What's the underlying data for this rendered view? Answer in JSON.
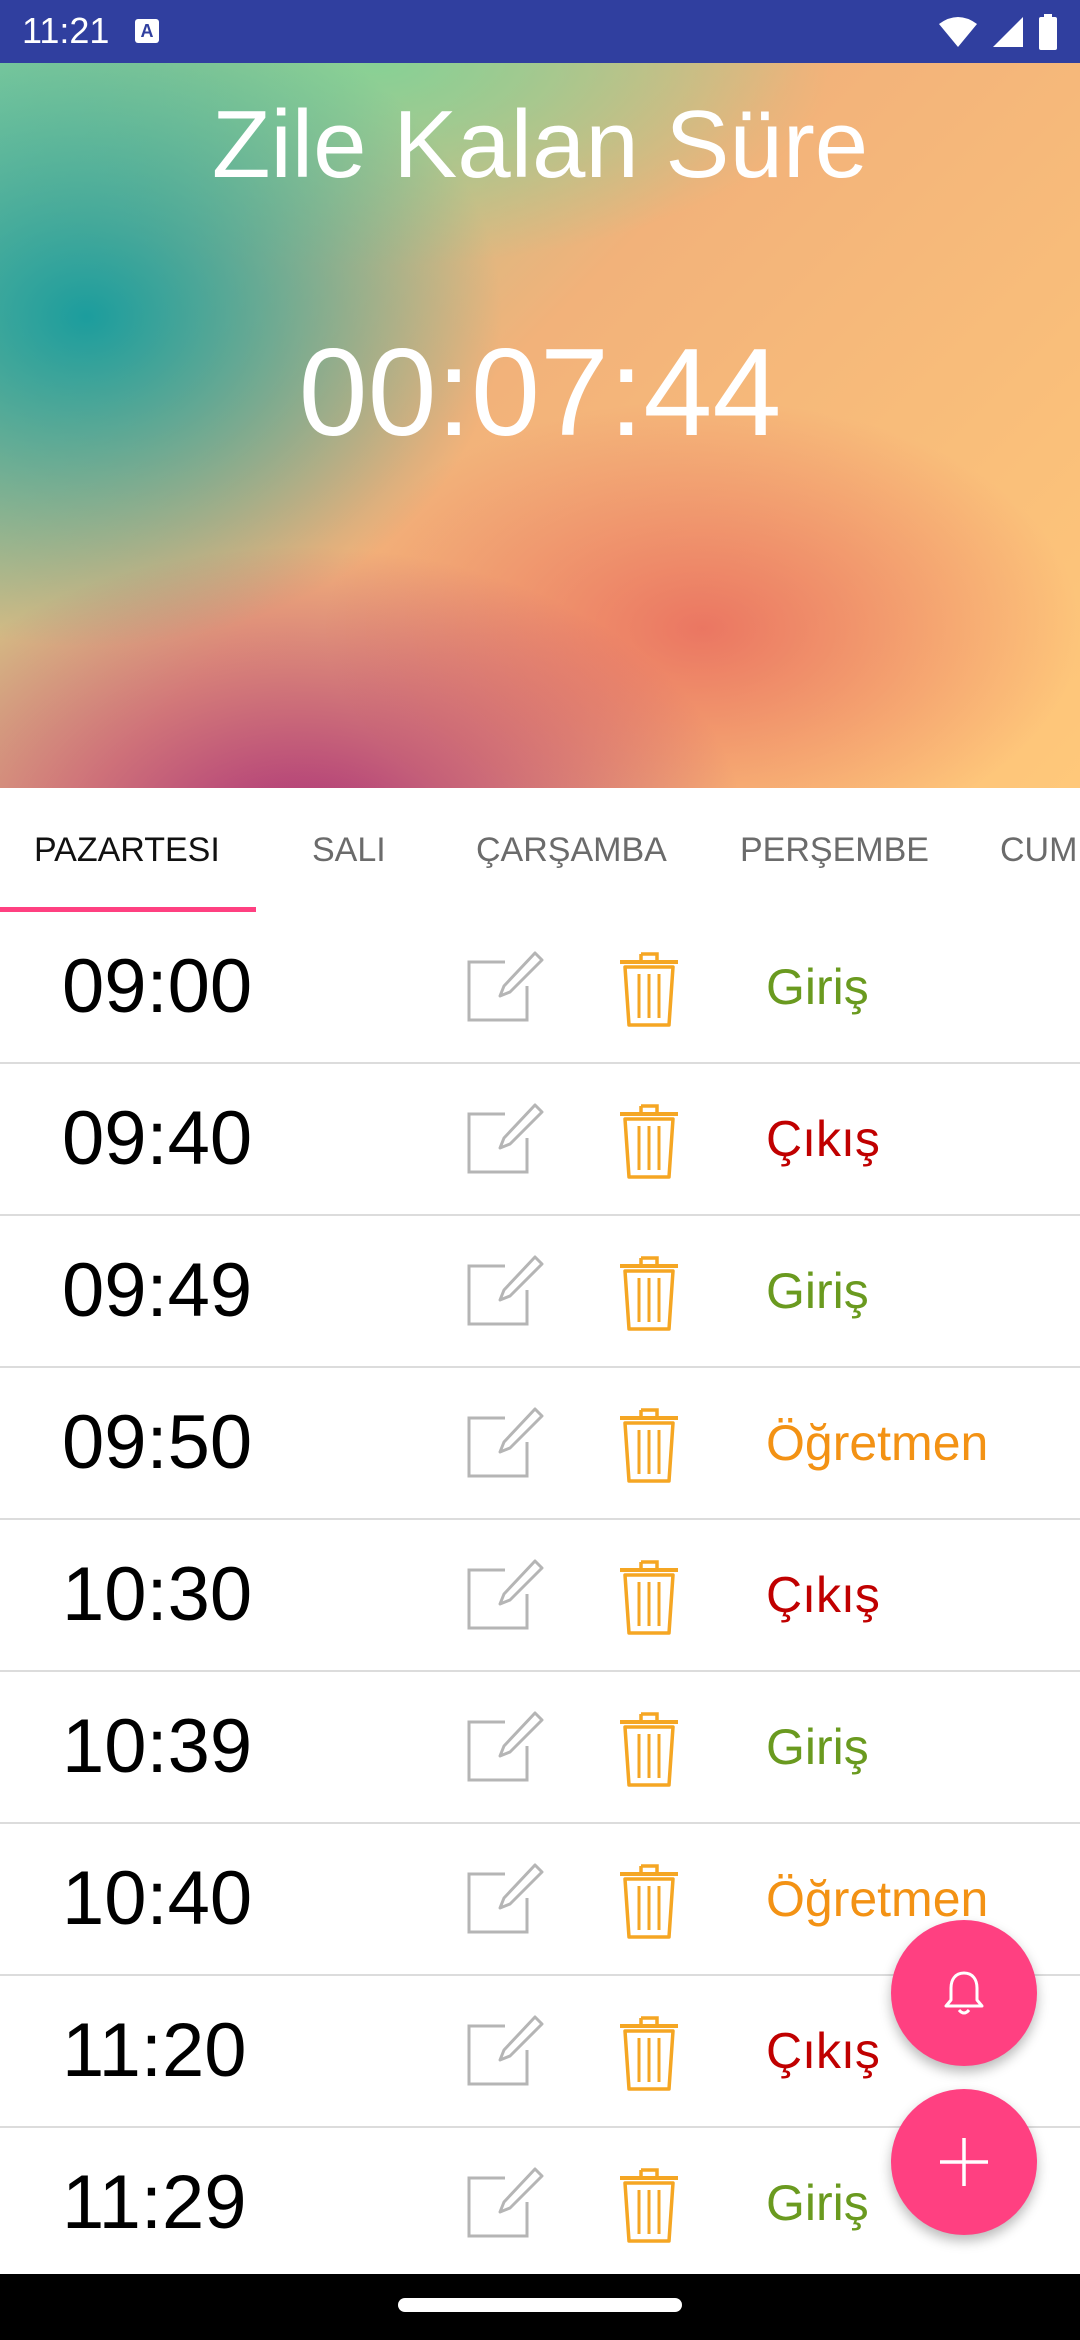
{
  "status_bar": {
    "time": "11:21",
    "notification_icon": "A",
    "icons": [
      "wifi-icon",
      "signal-icon",
      "battery-icon"
    ]
  },
  "header": {
    "title": "Zile Kalan Süre",
    "countdown": "00:07:44"
  },
  "tabs": [
    {
      "label": "PAZARTESI",
      "selected": true
    },
    {
      "label": "SALI",
      "selected": false
    },
    {
      "label": "ÇARŞAMBA",
      "selected": false
    },
    {
      "label": "PERŞEMBE",
      "selected": false
    },
    {
      "label": "CUM",
      "selected": false
    }
  ],
  "schedule": [
    {
      "time": "09:00",
      "type": "Giriş"
    },
    {
      "time": "09:40",
      "type": "Çıkış"
    },
    {
      "time": "09:49",
      "type": "Giriş"
    },
    {
      "time": "09:50",
      "type": "Öğretmen"
    },
    {
      "time": "10:30",
      "type": "Çıkış"
    },
    {
      "time": "10:39",
      "type": "Giriş"
    },
    {
      "time": "10:40",
      "type": "Öğretmen"
    },
    {
      "time": "11:20",
      "type": "Çıkış"
    },
    {
      "time": "11:29",
      "type": "Giriş"
    }
  ],
  "colors": {
    "accent": "#ff4081",
    "status_bar": "#303f9f",
    "giris": "#6a9a1f",
    "cikis": "#c00000",
    "ogretmen": "#f39214",
    "trash": "#f5a623"
  },
  "fabs": [
    {
      "icon": "bell-icon"
    },
    {
      "icon": "plus-icon"
    }
  ]
}
